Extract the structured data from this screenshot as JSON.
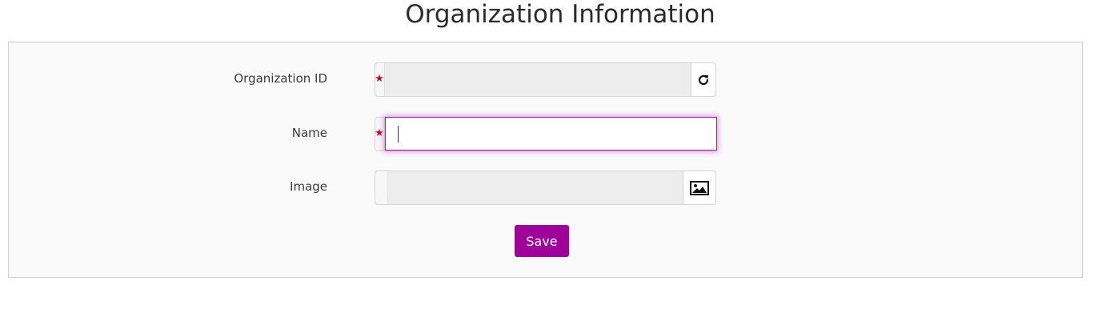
{
  "page": {
    "title": "Organization Information"
  },
  "form": {
    "organization_id": {
      "label": "Organization ID",
      "required_marker": "★",
      "value": "",
      "refresh_icon": "refresh-icon"
    },
    "name": {
      "label": "Name",
      "required_marker": "★",
      "value": ""
    },
    "image": {
      "label": "Image",
      "value": "",
      "image_icon": "image-icon"
    },
    "save_label": "Save"
  },
  "colors": {
    "accent": "#a0009a",
    "required": "#d0021b",
    "focus_border": "#a020a0"
  }
}
